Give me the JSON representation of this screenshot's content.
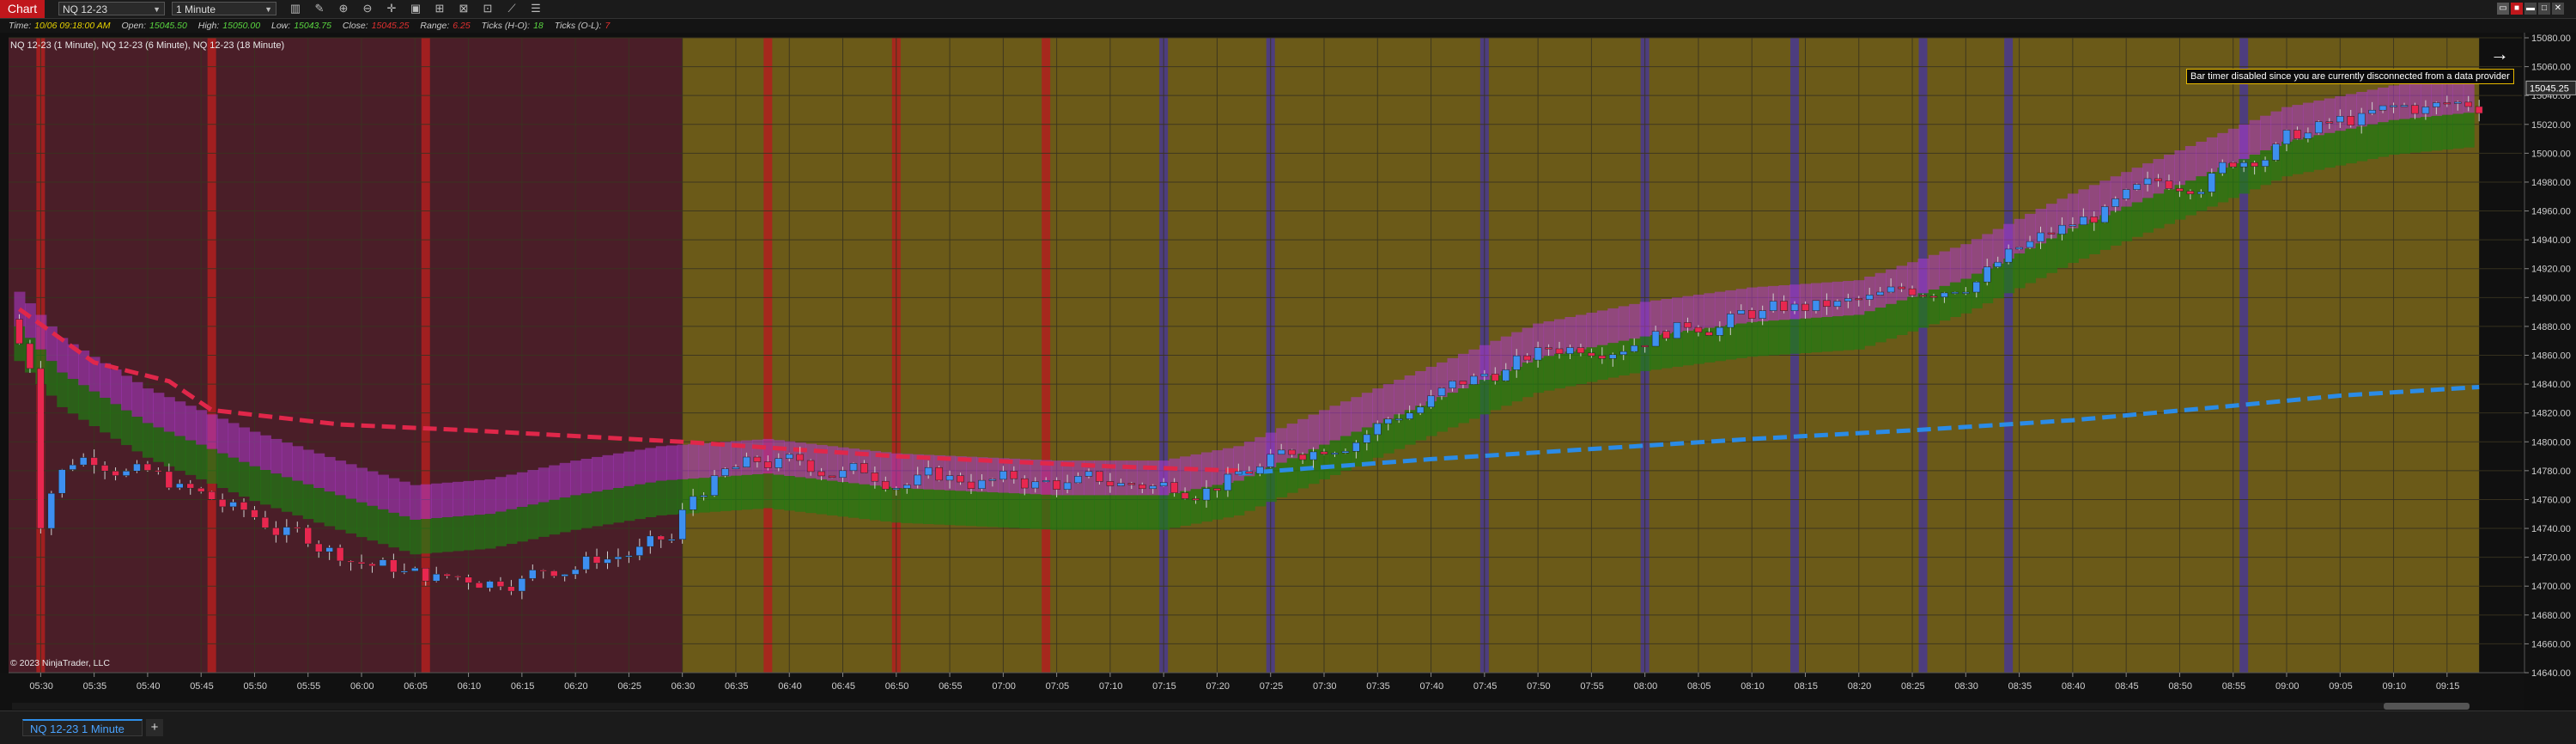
{
  "window": {
    "chart_tab": "Chart",
    "instrument": "NQ 12-23",
    "interval": "1 Minute"
  },
  "databox": {
    "time_label": "Time:",
    "time_value": "10/06 09:18:00 AM",
    "open_label": "Open:",
    "open_value": "15045.50",
    "high_label": "High:",
    "high_value": "15050.00",
    "low_label": "Low:",
    "low_value": "15043.75",
    "close_label": "Close:",
    "close_value": "15045.25",
    "range_label": "Range:",
    "range_value": "6.25",
    "ticks_hl_label": "Ticks (H-O):",
    "ticks_hl_value": "18",
    "ticks_ol_label": "Ticks (O-L):",
    "ticks_ol_value": "7"
  },
  "plot_label": "NQ 12-23 (1 Minute), NQ 12-23 (6 Minute), NQ 12-23 (18 Minute)",
  "copyright": "© 2023 NinjaTrader, LLC",
  "notice": "Bar timer disabled since you are currently disconnected from a data provider",
  "price_axis": {
    "labels": [
      "15080.00",
      "15060.00",
      "15040.00",
      "15020.00",
      "15000.00",
      "14980.00",
      "14960.00",
      "14940.00",
      "14920.00",
      "14900.00",
      "14880.00",
      "14860.00",
      "14840.00",
      "14820.00",
      "14800.00",
      "14780.00",
      "14760.00",
      "14740.00",
      "14720.00",
      "14700.00",
      "14680.00",
      "14660.00",
      "14640.00"
    ],
    "last_price": "15045.25"
  },
  "time_axis": {
    "labels": [
      "05:30",
      "05:35",
      "05:40",
      "05:45",
      "05:50",
      "05:55",
      "06:00",
      "06:05",
      "06:10",
      "06:15",
      "06:20",
      "06:25",
      "06:30",
      "06:35",
      "06:40",
      "06:45",
      "06:50",
      "06:55",
      "07:00",
      "07:05",
      "07:10",
      "07:15",
      "07:20",
      "07:25",
      "07:30",
      "07:35",
      "07:40",
      "07:45",
      "07:50",
      "07:55",
      "08:00",
      "08:05",
      "08:10",
      "08:15",
      "08:20",
      "08:25",
      "08:30",
      "08:35",
      "08:40",
      "08:45",
      "08:50",
      "08:55",
      "09:00",
      "09:05",
      "09:10",
      "09:15"
    ]
  },
  "bottom": {
    "tab_label": "NQ 12-23 1 Minute",
    "add_label": "+"
  },
  "colors": {
    "bull": "#3d8ff0",
    "bear": "#e8274f",
    "dashed_upper": "#e0274a",
    "dashed_lower": "#2b8be6",
    "bg_maroon": "#4a1e28",
    "bg_olive": "#6b5a18"
  }
}
